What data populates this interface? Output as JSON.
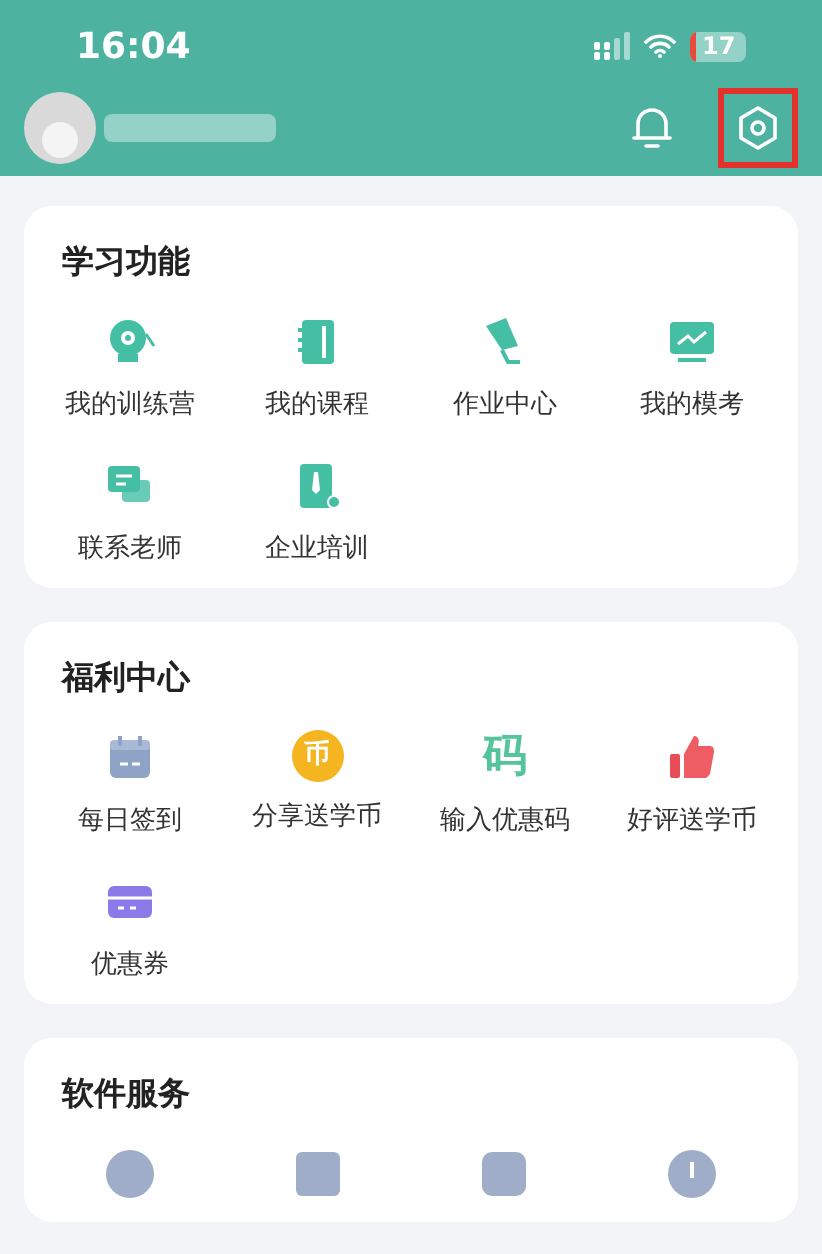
{
  "status_bar": {
    "time": "16:04",
    "battery": "17"
  },
  "header": {
    "settings_highlighted": true
  },
  "sections": [
    {
      "title": "学习功能",
      "items": [
        {
          "label": "我的训练营",
          "kind": "bell"
        },
        {
          "label": "我的课程",
          "kind": "notebook"
        },
        {
          "label": "作业中心",
          "kind": "megaphone"
        },
        {
          "label": "我的模考",
          "kind": "monitor"
        },
        {
          "label": "联系老师",
          "kind": "chat"
        },
        {
          "label": "企业培训",
          "kind": "badge"
        }
      ]
    },
    {
      "title": "福利中心",
      "items": [
        {
          "label": "每日签到",
          "kind": "calendar"
        },
        {
          "label": "分享送学币",
          "kind": "coin",
          "glyph": "币"
        },
        {
          "label": "输入优惠码",
          "kind": "code",
          "glyph": "码"
        },
        {
          "label": "好评送学币",
          "kind": "thumb"
        },
        {
          "label": "优惠券",
          "kind": "card"
        }
      ]
    },
    {
      "title": "软件服务",
      "items": [
        {
          "kind": "shield"
        },
        {
          "kind": "grid"
        },
        {
          "kind": "bag"
        },
        {
          "kind": "info"
        }
      ]
    }
  ]
}
